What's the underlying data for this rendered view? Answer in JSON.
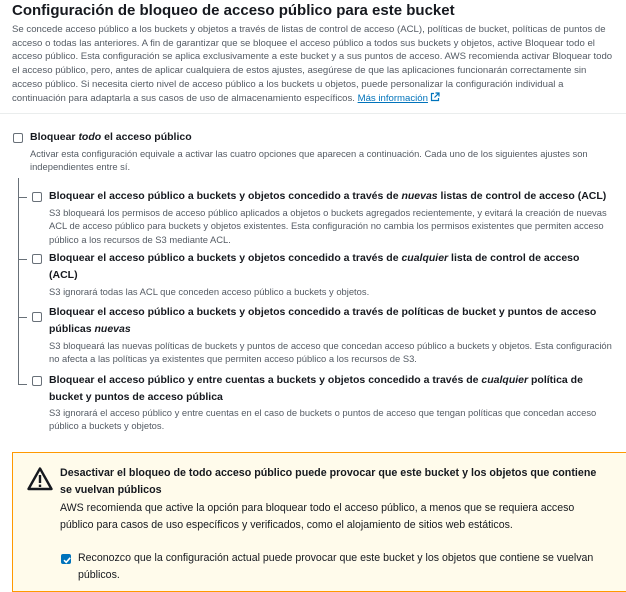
{
  "section": {
    "title": "Configuración de bloqueo de acceso público para este bucket",
    "description": "Se concede acceso público a los buckets y objetos a través de listas de control de acceso (ACL), políticas de bucket, políticas de puntos de acceso o todas las anteriores. A fin de garantizar que se bloquee el acceso público a todos sus buckets y objetos, active Bloquear todo el acceso público. Esta configuración se aplica exclusivamente a este bucket y a sus puntos de acceso. AWS recomienda activar Bloquear todo el acceso público, pero, antes de aplicar cualquiera de estos ajustes, asegúrese de que las aplicaciones funcionarán correctamente sin acceso público. Si necesita cierto nivel de acceso público a los buckets u objetos, puede personalizar la configuración individual a continuación para adaptarla a sus casos de uso de almacenamiento específicos.",
    "learn_more": "Más información"
  },
  "block_all": {
    "label_pre": "Bloquear ",
    "label_em": "todo",
    "label_post": " el acceso público",
    "description": "Activar esta configuración equivale a activar las cuatro opciones que aparecen a continuación. Cada uno de los siguientes ajustes son independientes entre sí.",
    "checked": false
  },
  "options": [
    {
      "label_pre": "Bloquear el acceso público a buckets y objetos concedido a través de ",
      "label_em": "nuevas",
      "label_post": " listas de control de acceso (ACL)",
      "description": "S3 bloqueará los permisos de acceso público aplicados a objetos o buckets agregados recientemente, y evitará la creación de nuevas ACL de acceso público para buckets y objetos existentes. Esta configuración no cambia los permisos existentes que permiten acceso público a los recursos de S3 mediante ACL.",
      "checked": false
    },
    {
      "label_pre": "Bloquear el acceso público a buckets y objetos concedido a través de ",
      "label_em": "cualquier",
      "label_post": " lista de control de acceso (ACL)",
      "description": "S3 ignorará todas las ACL que conceden acceso público a buckets y objetos.",
      "checked": false
    },
    {
      "label_pre": "Bloquear el acceso público a buckets y objetos concedido a través de políticas de bucket y puntos de acceso públicas ",
      "label_em": "nuevas",
      "label_post": "",
      "description": "S3 bloqueará las nuevas políticas de buckets y puntos de acceso que concedan acceso público a buckets y objetos. Esta configuración no afecta a las políticas ya existentes que permiten acceso público a los recursos de S3.",
      "checked": false
    },
    {
      "label_pre": "Bloquear el acceso público y entre cuentas a buckets y objetos concedido a través de ",
      "label_em": "cualquier",
      "label_post": " política de bucket y puntos de acceso pública",
      "description": "S3 ignorará el acceso público y entre cuentas en el caso de buckets o puntos de acceso que tengan políticas que concedan acceso público a buckets y objetos.",
      "checked": false
    }
  ],
  "warning": {
    "title": "Desactivar el bloqueo de todo acceso público puede provocar que este bucket y los objetos que contiene se vuelvan públicos",
    "body": "AWS recomienda que active la opción para bloquear todo el acceso público, a menos que se requiera acceso público para casos de uso específicos y verificados, como el alojamiento de sitios web estáticos.",
    "acknowledge": "Reconozco que la configuración actual puede provocar que este bucket y los objetos que contiene se vuelvan públicos.",
    "acknowledged": true,
    "icon": "warning-triangle-icon",
    "border_color": "#ff9900",
    "background_color": "#fffbeb"
  },
  "colors": {
    "link": "#0073bb",
    "checkbox_checked": "#0073bb",
    "text": "#16191f",
    "secondary_text": "#545b64"
  }
}
